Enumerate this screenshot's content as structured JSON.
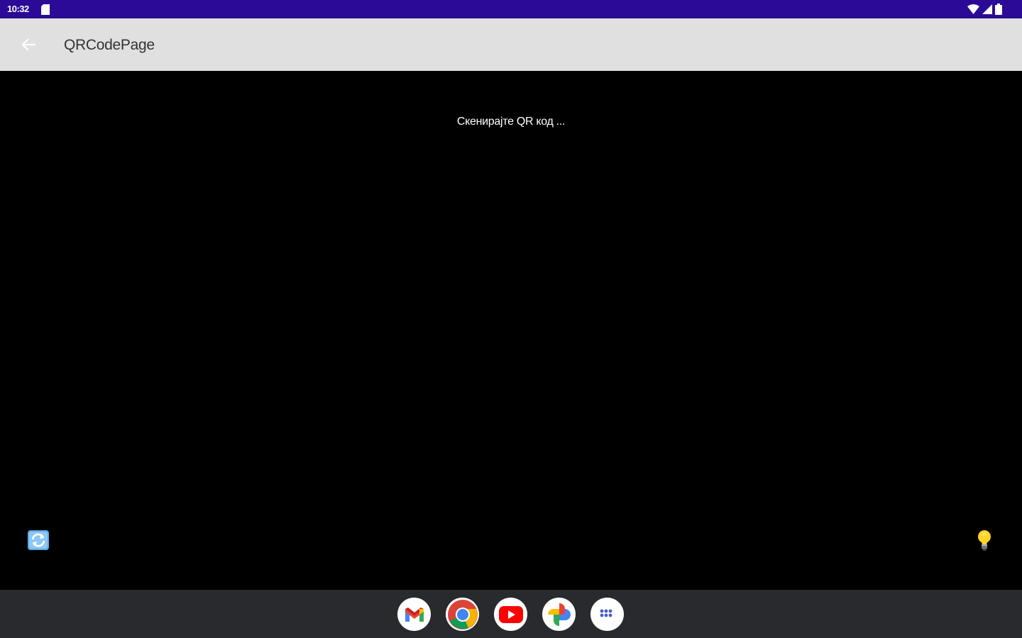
{
  "status_bar": {
    "time": "10:32",
    "background": "#2a0a96",
    "icons": [
      "sd-card-icon",
      "wifi-icon",
      "signal-icon",
      "battery-icon"
    ]
  },
  "app_bar": {
    "title": "QRCodePage",
    "back_icon": "arrow-left-icon",
    "background": "#e0e0e0"
  },
  "scanner": {
    "prompt": "Скенирајте QR код ...",
    "switch_camera_icon": "camera-switch-icon",
    "flashlight_icon": "light-bulb-icon"
  },
  "taskbar": {
    "background": "#282a2d",
    "apps": [
      {
        "name": "gmail-icon"
      },
      {
        "name": "chrome-icon"
      },
      {
        "name": "youtube-icon"
      },
      {
        "name": "photos-icon"
      },
      {
        "name": "app-drawer-icon"
      }
    ]
  }
}
